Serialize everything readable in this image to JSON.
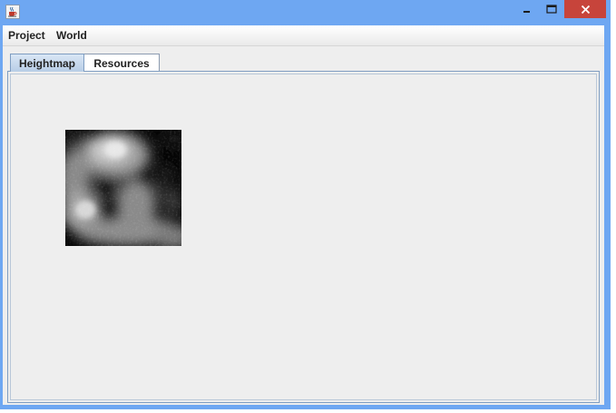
{
  "menu": {
    "items": [
      "Project",
      "World"
    ]
  },
  "tabs": [
    {
      "label": "Heightmap",
      "active": true
    },
    {
      "label": "Resources",
      "active": false
    }
  ],
  "colors": {
    "titlebar": "#6ea7f2",
    "close_button": "#c7443b",
    "panel_background": "#eeeeee"
  },
  "icons": {
    "app": "java-cup-icon",
    "minimize": "minimize-icon",
    "maximize": "maximize-icon",
    "close": "close-icon"
  }
}
